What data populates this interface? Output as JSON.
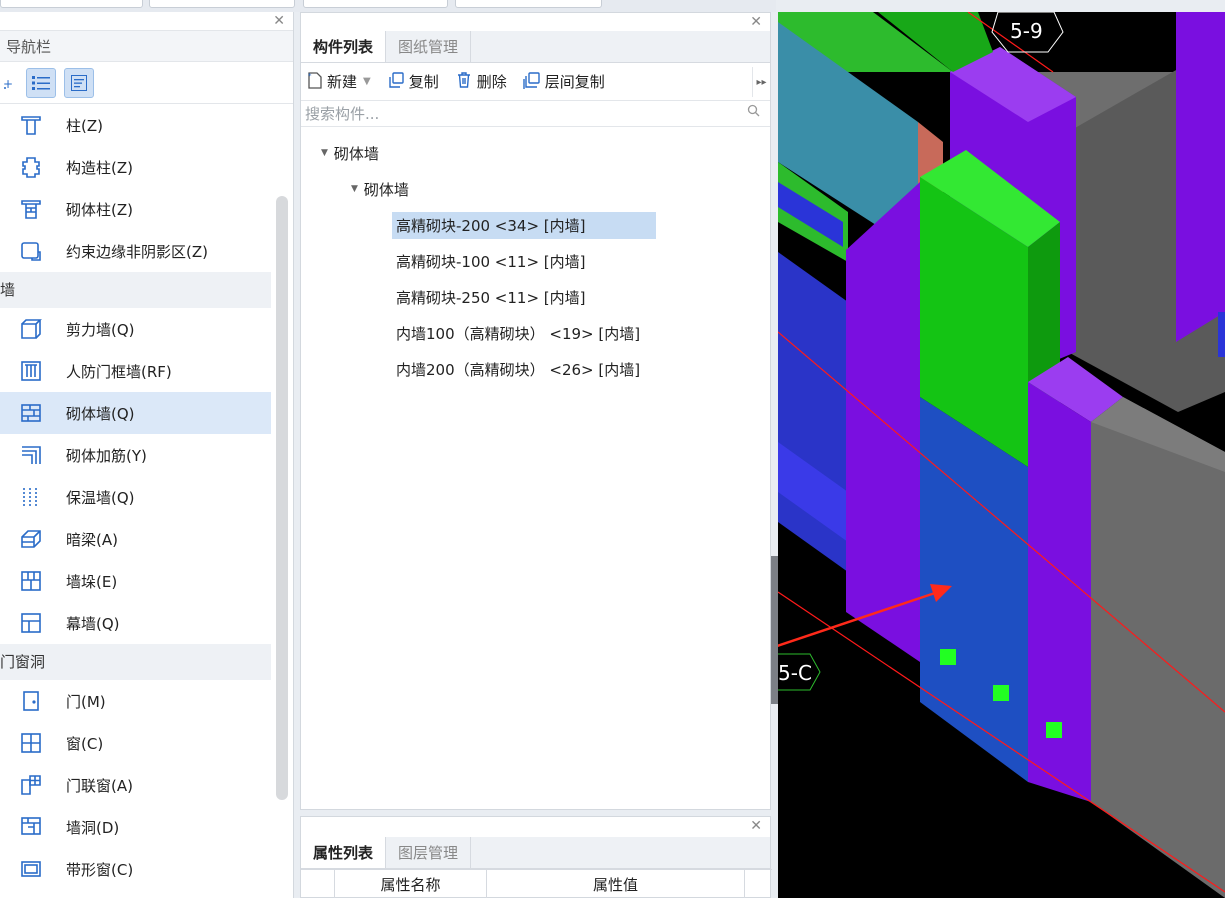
{
  "nav": {
    "title": "导航栏",
    "items": [
      {
        "label": "柱(Z)",
        "icon": "column-icon"
      },
      {
        "label": "构造柱(Z)",
        "icon": "constructional-column-icon"
      },
      {
        "label": "砌体柱(Z)",
        "icon": "masonry-column-icon"
      },
      {
        "label": "约束边缘非阴影区(Z)",
        "icon": "constraint-edge-icon"
      }
    ],
    "group_wall": "墙",
    "wall_items": [
      {
        "label": "剪力墙(Q)",
        "icon": "shear-wall-icon"
      },
      {
        "label": "人防门框墙(RF)",
        "icon": "civil-defense-door-frame-wall-icon"
      },
      {
        "label": "砌体墙(Q)",
        "icon": "masonry-wall-icon",
        "active": true
      },
      {
        "label": "砌体加筋(Y)",
        "icon": "masonry-reinforcement-icon"
      },
      {
        "label": "保温墙(Q)",
        "icon": "insulation-wall-icon"
      },
      {
        "label": "暗梁(A)",
        "icon": "hidden-beam-icon"
      },
      {
        "label": "墙垛(E)",
        "icon": "wall-pier-icon"
      },
      {
        "label": "幕墙(Q)",
        "icon": "curtain-wall-icon"
      }
    ],
    "group_opening": "门窗洞",
    "opening_items": [
      {
        "label": "门(M)",
        "icon": "door-icon"
      },
      {
        "label": "窗(C)",
        "icon": "window-icon"
      },
      {
        "label": "门联窗(A)",
        "icon": "door-window-icon"
      },
      {
        "label": "墙洞(D)",
        "icon": "wall-hole-icon"
      },
      {
        "label": "带形窗(C)",
        "icon": "strip-window-icon"
      }
    ]
  },
  "comp": {
    "tabs": [
      "构件列表",
      "图纸管理"
    ],
    "toolbar": {
      "new_label": "新建",
      "copy_label": "复制",
      "delete_label": "删除",
      "floor_copy_label": "层间复制"
    },
    "search_placeholder": "搜索构件...",
    "tree": {
      "root": "砌体墙",
      "child": "砌体墙",
      "items": [
        "高精砌块-200 <34> [内墙]",
        "高精砌块-100 <11> [内墙]",
        "高精砌块-250 <11> [内墙]",
        "内墙100（高精砌块） <19> [内墙]",
        "内墙200（高精砌块） <26> [内墙]"
      ]
    }
  },
  "props": {
    "tabs": [
      "属性列表",
      "图层管理"
    ],
    "col_name": "属性名称",
    "col_value": "属性值"
  },
  "viewport": {
    "label_top": "5-9",
    "label_left": "5-C"
  },
  "colors": {
    "accent": "#2a6cc8",
    "selection": "#c7dcf3",
    "wall_purple": "#7a0fe0",
    "wall_green": "#14c414",
    "wall_blue": "#1e4fc2",
    "wall_gray": "#6b6b6b",
    "arrow_red": "#ff2a1a"
  }
}
